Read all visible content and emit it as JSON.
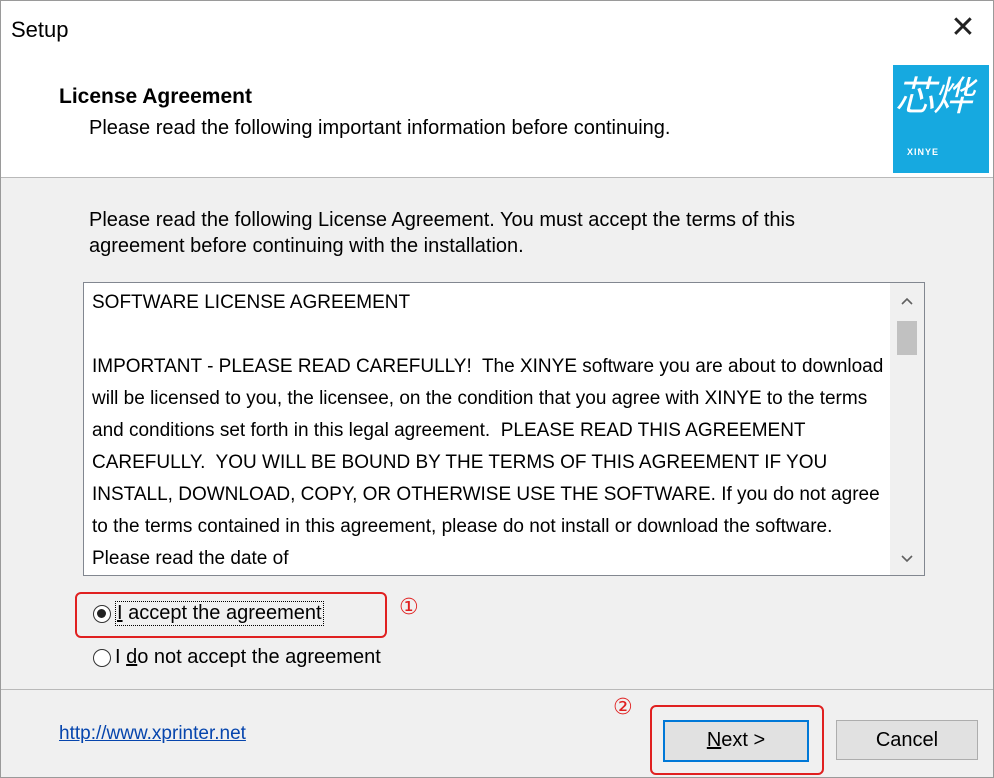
{
  "window": {
    "title": "Setup",
    "close_glyph": "✕"
  },
  "header": {
    "title": "License Agreement",
    "subtitle": "Please read the following important information before continuing.",
    "logo_text": "芯烨",
    "logo_subtext": "XINYE"
  },
  "intro": "Please read the following License Agreement. You must accept the terms of this agreement before continuing with the installation.",
  "license": {
    "text": "SOFTWARE LICENSE AGREEMENT\n\nIMPORTANT - PLEASE READ CAREFULLY!  The XINYE software you are about to download will be licensed to you, the licensee, on the condition that you agree with XINYE to the terms and conditions set forth in this legal agreement.  PLEASE READ THIS AGREEMENT CAREFULLY.  YOU WILL BE BOUND BY THE TERMS OF THIS AGREEMENT IF YOU INSTALL, DOWNLOAD, COPY, OR OTHERWISE USE THE SOFTWARE. If you do not agree to the terms contained in this agreement, please do not install or download the software. Please read the date of"
  },
  "options": {
    "accept_pre": "I",
    "accept_post": " accept the agreement",
    "decline_pre": "I ",
    "decline_underline": "d",
    "decline_post": "o not accept the agreement",
    "selected": "accept"
  },
  "annotations": {
    "marker_1": "①",
    "marker_2": "②",
    "color": "#e02020"
  },
  "footer": {
    "link": "http://www.xprinter.net",
    "next_underline": "N",
    "next_rest": "ext >",
    "cancel": "Cancel"
  },
  "colors": {
    "logo_bg": "#16a9e0",
    "focus_border": "#0078d7",
    "link": "#0645ad"
  }
}
